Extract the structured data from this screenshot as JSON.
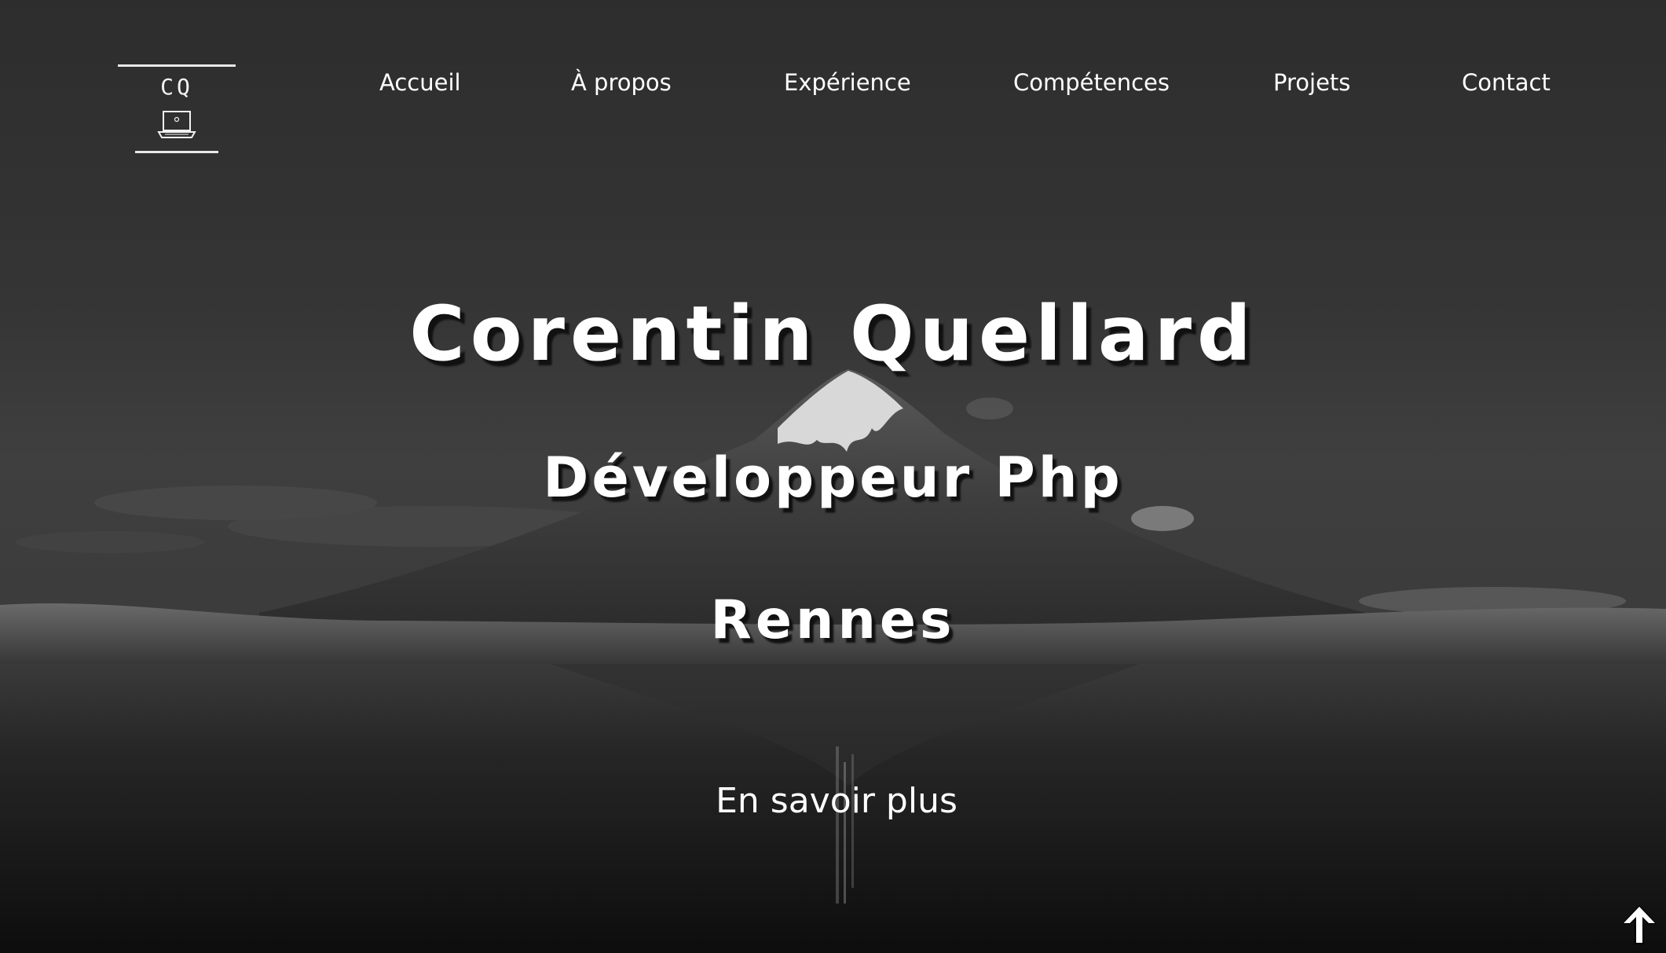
{
  "logo": {
    "initials": "CQ",
    "icon": "laptop-icon"
  },
  "nav": {
    "items": [
      {
        "label": "Accueil"
      },
      {
        "label": "À propos"
      },
      {
        "label": "Expérience"
      },
      {
        "label": "Compétences"
      },
      {
        "label": "Projets"
      },
      {
        "label": "Contact"
      }
    ]
  },
  "hero": {
    "name": "Corentin Quellard",
    "role": "Développeur Php",
    "city": "Rennes",
    "cta_label": "En savoir plus",
    "background": "mountain-lake-photo"
  },
  "scroll_top": {
    "icon": "arrow-up-icon"
  },
  "colors": {
    "text": "#ffffff",
    "background": "#2f2f2f",
    "shadow": "#111111"
  }
}
